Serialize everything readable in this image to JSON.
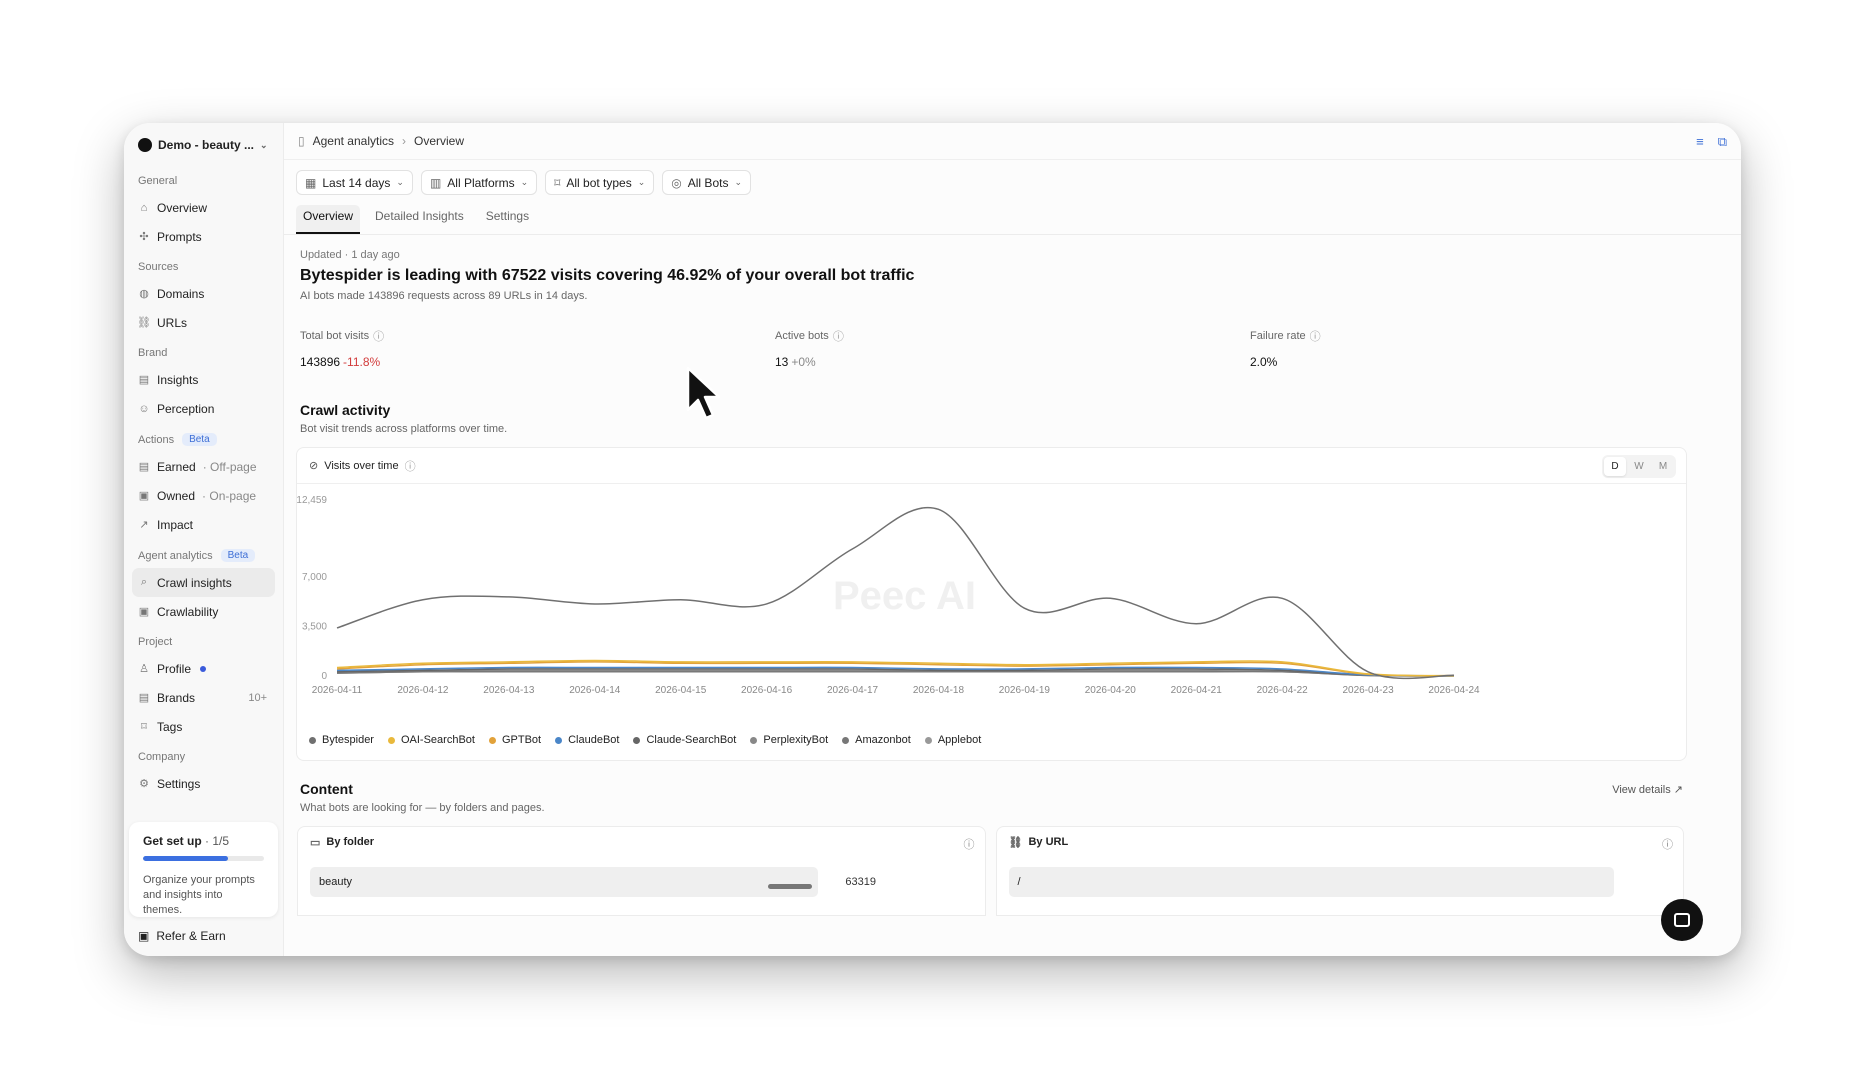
{
  "workspace": {
    "name": "Demo - beauty ..."
  },
  "sidebar": {
    "sections": [
      {
        "label": "General",
        "items": [
          {
            "label": "Overview",
            "icon": "home-icon"
          },
          {
            "label": "Prompts",
            "icon": "prompts-icon"
          }
        ]
      },
      {
        "label": "Sources",
        "items": [
          {
            "label": "Domains",
            "icon": "globe-icon"
          },
          {
            "label": "URLs",
            "icon": "link-icon"
          }
        ]
      },
      {
        "label": "Brand",
        "items": [
          {
            "label": "Insights",
            "icon": "doc-icon"
          },
          {
            "label": "Perception",
            "icon": "smile-icon"
          }
        ]
      },
      {
        "label": "Actions",
        "badge": "Beta",
        "items": [
          {
            "label": "Earned",
            "sub": "· Off-page",
            "icon": "doc-icon"
          },
          {
            "label": "Owned",
            "sub": "· On-page",
            "icon": "page-icon"
          },
          {
            "label": "Impact",
            "icon": "trend-icon"
          }
        ]
      },
      {
        "label": "Agent analytics",
        "badge": "Beta",
        "items": [
          {
            "label": "Crawl insights",
            "icon": "search-icon",
            "active": true
          },
          {
            "label": "Crawlability",
            "icon": "page-icon"
          }
        ]
      },
      {
        "label": "Project",
        "items": [
          {
            "label": "Profile",
            "icon": "user-icon",
            "dot": true
          },
          {
            "label": "Brands",
            "icon": "doc-icon",
            "count": "10+"
          },
          {
            "label": "Tags",
            "icon": "tag-icon"
          }
        ]
      },
      {
        "label": "Company",
        "items": [
          {
            "label": "Settings",
            "icon": "gear-icon"
          }
        ]
      }
    ],
    "setup": {
      "title": "Get set up",
      "progress_text": "· 1/5",
      "progress": 0.2,
      "description": "Organize your prompts and insights into themes."
    },
    "refer": "Refer & Earn"
  },
  "breadcrumb": {
    "parent": "Agent analytics",
    "current": "Overview"
  },
  "filters": [
    "Last 14 days",
    "All Platforms",
    "All bot types",
    "All Bots"
  ],
  "tabs": [
    {
      "label": "Overview",
      "active": true
    },
    {
      "label": "Detailed Insights"
    },
    {
      "label": "Settings"
    }
  ],
  "summary": {
    "updated": "Updated · 1 day ago",
    "headline": "Bytespider is leading with 67522 visits covering 46.92% of your overall bot traffic",
    "subline": "AI bots made 143896 requests across 89 URLs in 14 days."
  },
  "stats": [
    {
      "label": "Total bot visits",
      "value": "143896",
      "delta": "-11.8%",
      "delta_type": "neg"
    },
    {
      "label": "Active bots",
      "value": "13",
      "delta": "+0%",
      "delta_type": "muted"
    },
    {
      "label": "Failure rate",
      "value": "2.0%",
      "delta": ""
    }
  ],
  "crawl": {
    "title": "Crawl activity",
    "subtitle": "Bot visit trends across platforms over time.",
    "card_title": "Visits over time",
    "granularity": [
      "D",
      "W",
      "M"
    ],
    "active_granularity": "D"
  },
  "chart_data": {
    "type": "line",
    "x": [
      "2026-04-11",
      "2026-04-12",
      "2026-04-13",
      "2026-04-14",
      "2026-04-15",
      "2026-04-16",
      "2026-04-17",
      "2026-04-18",
      "2026-04-19",
      "2026-04-20",
      "2026-04-21",
      "2026-04-22",
      "2026-04-23",
      "2026-04-24"
    ],
    "y_ticks": [
      0,
      3500,
      7000,
      12459
    ],
    "y_tick_labels": [
      "0",
      "3,500",
      "7,000",
      "12,459"
    ],
    "ylim": [
      0,
      12459
    ],
    "grid": false,
    "legend_placement": "bottom-left",
    "watermark": "Peec AI",
    "series": [
      {
        "name": "Bytespider",
        "color": "#707070",
        "values": [
          3400,
          5400,
          5600,
          5100,
          5400,
          5100,
          9000,
          11800,
          4800,
          5500,
          3700,
          5500,
          300,
          50
        ]
      },
      {
        "name": "OAI-SearchBot",
        "color": "#e9b93c",
        "values": [
          600,
          900,
          1000,
          1100,
          1000,
          1000,
          1000,
          900,
          800,
          900,
          1000,
          1000,
          150,
          20
        ]
      },
      {
        "name": "GPTBot",
        "color": "#e2a23a",
        "values": [
          500,
          800,
          900,
          1000,
          900,
          900,
          900,
          800,
          700,
          800,
          900,
          900,
          120,
          20
        ]
      },
      {
        "name": "ClaudeBot",
        "color": "#4a86c8",
        "values": [
          400,
          500,
          600,
          600,
          600,
          600,
          600,
          500,
          500,
          600,
          600,
          500,
          80,
          10
        ]
      },
      {
        "name": "Claude-SearchBot",
        "color": "#666666",
        "values": [
          300,
          400,
          500,
          500,
          500,
          500,
          500,
          400,
          400,
          500,
          500,
          400,
          60,
          10
        ]
      },
      {
        "name": "PerplexityBot",
        "color": "#888888",
        "values": [
          300,
          400,
          400,
          400,
          400,
          400,
          400,
          400,
          400,
          400,
          400,
          400,
          50,
          10
        ]
      },
      {
        "name": "Amazonbot",
        "color": "#777777",
        "values": [
          200,
          300,
          300,
          300,
          300,
          300,
          300,
          300,
          300,
          300,
          300,
          300,
          40,
          10
        ]
      },
      {
        "name": "Applebot",
        "color": "#999999",
        "values": [
          200,
          300,
          300,
          300,
          300,
          300,
          300,
          300,
          300,
          300,
          300,
          300,
          30,
          10
        ]
      }
    ]
  },
  "content": {
    "title": "Content",
    "subtitle": "What bots are looking for — by folders and pages.",
    "view_details": "View details ↗",
    "by_folder": {
      "title": "By folder",
      "rows": [
        {
          "label": "beauty",
          "value": "63319"
        }
      ]
    },
    "by_url": {
      "title": "By URL",
      "rows": [
        {
          "label": "/"
        }
      ]
    }
  }
}
